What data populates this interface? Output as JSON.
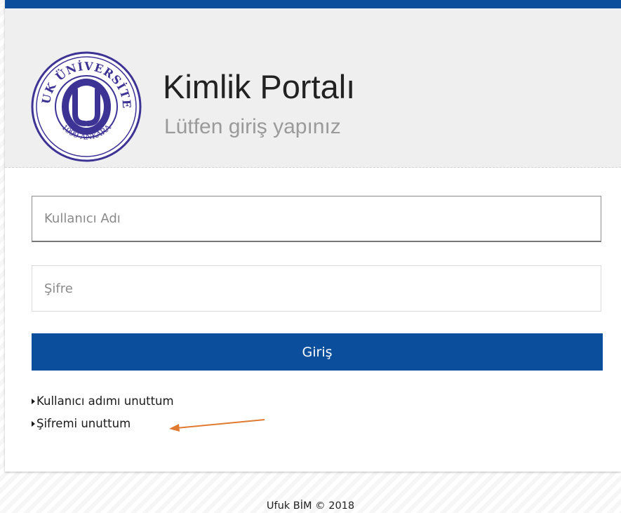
{
  "header": {
    "title": "Kimlik Portalı",
    "subtitle": "Lütfen giriş yapınız"
  },
  "logo": {
    "arc_text_top": "UFUK ÜNİVERSİTESİ",
    "arc_text_bottom": "1999 ANKARA",
    "icon": "university-seal",
    "color": "#3d3394"
  },
  "form": {
    "username_placeholder": "Kullanıcı Adı",
    "username_value": "",
    "password_placeholder": "Şifre",
    "password_value": "",
    "submit_label": "Giriş"
  },
  "links": {
    "forgot_username": "Kullanıcı adımı unuttum",
    "forgot_password": "Şifremi unuttum"
  },
  "annotation": {
    "icon": "arrow-left-icon",
    "color": "#e07a30"
  },
  "footer": {
    "text": "Ufuk BİM © 2018"
  },
  "colors": {
    "accent": "#0b4f9c",
    "header_bg": "#efefef"
  }
}
